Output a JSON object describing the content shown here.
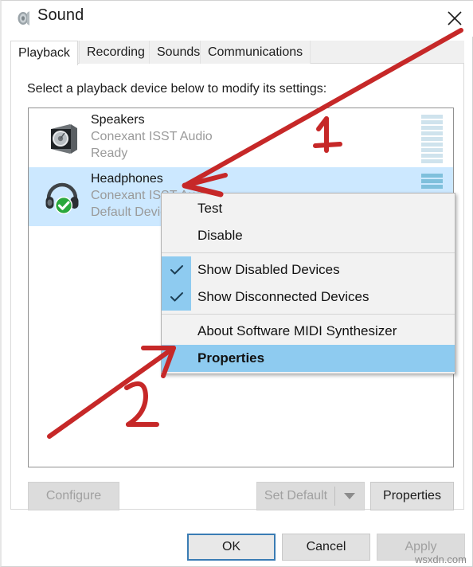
{
  "window": {
    "title": "Sound",
    "icon": "speaker-icon",
    "close_label": "✕"
  },
  "tabs": [
    {
      "label": "Playback",
      "selected": true
    },
    {
      "label": "Recording",
      "selected": false
    },
    {
      "label": "Sounds",
      "selected": false
    },
    {
      "label": "Communications",
      "selected": false
    }
  ],
  "page": {
    "prompt": "Select a playback device below to modify its settings:"
  },
  "devices": [
    {
      "icon": "speaker-device-icon",
      "name": "Speakers",
      "description": "Conexant ISST Audio",
      "state": "Ready",
      "selected": false,
      "default_device": false,
      "vu_segments_total": 9,
      "vu_segments_active": 0
    },
    {
      "icon": "headphones-device-icon",
      "name": "Headphones",
      "description": "Conexant ISST Audio",
      "state": "Default Device",
      "selected": true,
      "default_device": true,
      "vu_segments_total": 3,
      "vu_segments_active": 3
    }
  ],
  "context_menu": {
    "items": [
      {
        "label": "Test",
        "checked": false,
        "highlighted": false,
        "bold": false
      },
      {
        "label": "Disable",
        "checked": false,
        "highlighted": false,
        "bold": false
      },
      {
        "separator": true
      },
      {
        "label": "Show Disabled Devices",
        "checked": true,
        "highlighted": false,
        "bold": false
      },
      {
        "label": "Show Disconnected Devices",
        "checked": true,
        "highlighted": false,
        "bold": false
      },
      {
        "separator": true
      },
      {
        "label": "About Software MIDI Synthesizer",
        "checked": false,
        "highlighted": false,
        "bold": false
      },
      {
        "label": "Properties",
        "checked": false,
        "highlighted": true,
        "bold": true
      }
    ],
    "check_glyph": "✓",
    "highlight_color": "#8ecbf0"
  },
  "page_buttons": {
    "configure": {
      "label": "Configure",
      "enabled": false
    },
    "set_default": {
      "label": "Set Default",
      "enabled": false,
      "has_dropdown": true
    },
    "properties": {
      "label": "Properties",
      "enabled": true
    }
  },
  "dialog_buttons": {
    "ok": {
      "label": "OK",
      "enabled": true,
      "default": true
    },
    "cancel": {
      "label": "Cancel",
      "enabled": true,
      "default": false
    },
    "apply": {
      "label": "Apply",
      "enabled": false,
      "default": false
    }
  },
  "annotations": {
    "color": "#c62828",
    "marker_one": "1",
    "marker_two": "2"
  },
  "watermark": {
    "text": "wsxdn.com"
  }
}
